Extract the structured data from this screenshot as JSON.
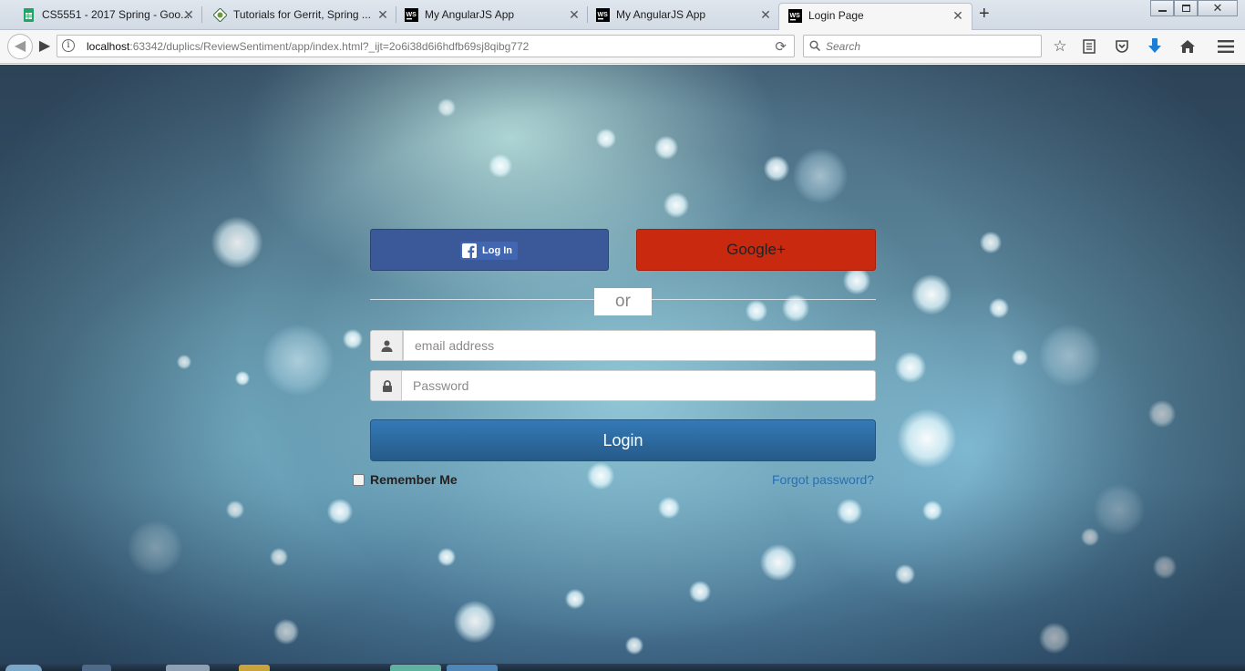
{
  "browser": {
    "tabs": [
      {
        "title": "CS5551 - 2017 Spring - Goo...",
        "favicon": "sheets-icon",
        "active": false
      },
      {
        "title": "Tutorials for Gerrit, Spring ...",
        "favicon": "tutorial-icon",
        "active": false
      },
      {
        "title": "My AngularJS App",
        "favicon": "webstorm-icon",
        "active": false
      },
      {
        "title": "My AngularJS App",
        "favicon": "webstorm-icon",
        "active": false
      },
      {
        "title": "Login Page",
        "favicon": "webstorm-icon",
        "active": true
      }
    ],
    "url_host": "localhost",
    "url_rest": ":63342/duplics/ReviewSentiment/app/index.html?_ijt=2o6i38d6i6hdfb69sj8qibg772",
    "search_placeholder": "Search",
    "colors": {
      "tabstrip": "#d2dae4",
      "navbar": "#f6f6f6"
    }
  },
  "login": {
    "facebook_label": "Log In",
    "google_label": "Google+",
    "divider_text": "or",
    "email_placeholder": "email address",
    "password_placeholder": "Password",
    "submit_label": "Login",
    "remember_label": "Remember Me",
    "remember_checked": false,
    "forgot_label": "Forgot password?",
    "colors": {
      "facebook": "#3b5998",
      "google": "#c8290f",
      "primary": "#337ab7",
      "link": "#2a6fb0"
    }
  }
}
